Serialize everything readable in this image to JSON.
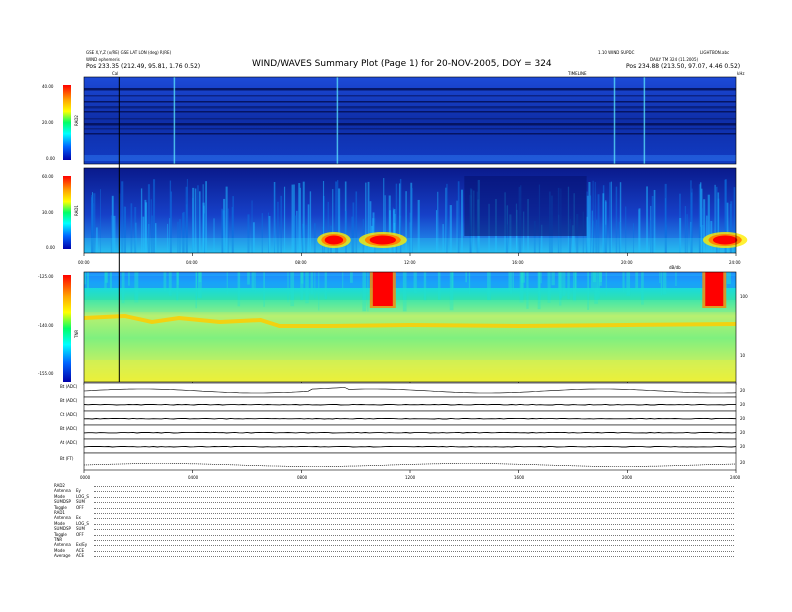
{
  "header": {
    "ephemeris_line": "GSE X,Y,Z (x/RE) GSE LAT LON (deg) R(RE)",
    "ephemeris_label": "WIND ephemeris",
    "left_pos": "Pos   233.35 (212.49, 95.81, 1.76 0.52)",
    "title": "WIND/WAVES Summary Plot (Page 1) for 20-NOV-2005, DOY = 324",
    "right_top": "1.10 WIND SUPDC",
    "right_top2": "LIGHTBON.abc",
    "right_mid": "DAILY TM 324 (11.2005)",
    "right_pos": "Pos   234.88 (213.50, 97.07, 4.46 0.52)",
    "timeline_label": "TIMELINE",
    "khz_label": "kHz",
    "cal_label": "Cal"
  },
  "panels": {
    "rad2": {
      "label": "RAD2",
      "ticks": [
        "40.00",
        "20.00",
        "0.00"
      ]
    },
    "rad1": {
      "label": "RAD1",
      "ticks": [
        "60.00",
        "30.00",
        "0.00"
      ]
    },
    "tnr": {
      "label": "TNR",
      "ticks": [
        "-125.00",
        "-140.00",
        "-155.00"
      ],
      "right_ticks": [
        "100",
        "10"
      ],
      "right_label": "dB/db"
    }
  },
  "chart_data": {
    "type": "heatmap",
    "x_ticks": [
      "00:00",
      "04:00",
      "08:00",
      "12:00",
      "16:00",
      "20:00",
      "24:00"
    ],
    "bottom_x_ticks": [
      "0000",
      "0400",
      "0800",
      "1200",
      "1600",
      "2000",
      "2400"
    ],
    "xlim": [
      0,
      24
    ],
    "rad2_ylim": [
      0,
      40
    ],
    "rad1_ylim": [
      0,
      60
    ],
    "tnr_ylim": [
      -155,
      -125
    ],
    "cal_hour": 1.3,
    "bursts": [
      {
        "panel": "rad1",
        "hour": 11.0,
        "intensity": 1.0
      },
      {
        "panel": "rad1",
        "hour": 23.6,
        "intensity": 0.9
      },
      {
        "panel": "rad1",
        "hour": 9.2,
        "intensity": 0.6
      },
      {
        "panel": "tnr",
        "hour": 11.0,
        "intensity": 1.0
      },
      {
        "panel": "tnr",
        "hour": 23.2,
        "intensity": 0.9
      }
    ]
  },
  "strip_panels": [
    {
      "label": "Bt (ADC)",
      "right": "20"
    },
    {
      "label": "Bt (ADC)",
      "right": "20"
    },
    {
      "label": "Ct (ADC)",
      "right": "20"
    },
    {
      "label": "Bt (ADC)",
      "right": "20"
    },
    {
      "label": "At (ADC)",
      "right": "20"
    },
    {
      "label": "Bt (FT)",
      "right": "20"
    }
  ],
  "params": [
    {
      "key": "RAD2",
      "value": ""
    },
    {
      "key": "Antenna",
      "value": "Ey"
    },
    {
      "key": "Mode",
      "value": "LOG_S"
    },
    {
      "key": "SUMDSP",
      "value": "SUM"
    },
    {
      "key": "Toggle",
      "value": "OFF"
    },
    {
      "key": "RAD1",
      "value": ""
    },
    {
      "key": "Antenna",
      "value": "Ex"
    },
    {
      "key": "Mode",
      "value": "LOG_S"
    },
    {
      "key": "SUMDSP",
      "value": "SUM"
    },
    {
      "key": "Toggle",
      "value": "OFF"
    },
    {
      "key": "TNR",
      "value": ""
    },
    {
      "key": "Antenna",
      "value": "Ex/Ey"
    },
    {
      "key": "Mode",
      "value": "ACE"
    },
    {
      "key": "Average",
      "value": "ACE"
    }
  ],
  "colors": {
    "background": "#0a1a8c",
    "colorbar": [
      "#ff0000",
      "#ffa500",
      "#ffff00",
      "#00ff66",
      "#00ffff",
      "#0066ff",
      "#0000aa"
    ]
  }
}
